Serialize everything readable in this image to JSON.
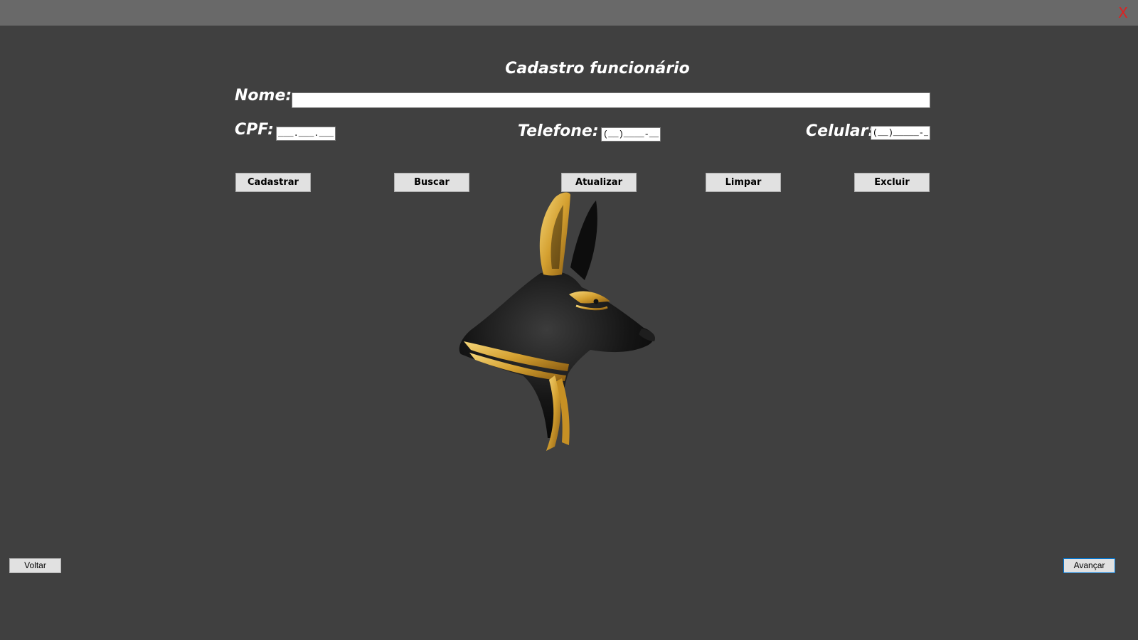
{
  "window": {
    "close_label": "X"
  },
  "form": {
    "title": "Cadastro funcionário",
    "nome_label": "Nome:",
    "nome_value": "",
    "cpf_label": "CPF:",
    "cpf_mask": "___.___.___-__",
    "telefone_label": "Telefone:",
    "telefone_mask": "(__)____-____",
    "celular_label": "Celular:",
    "celular_mask": "(__)_____-____"
  },
  "actions": {
    "cadastrar": "Cadastrar",
    "buscar": "Buscar",
    "atualizar": "Atualizar",
    "limpar": "Limpar",
    "excluir": "Excluir"
  },
  "navigation": {
    "voltar": "Voltar",
    "avancar": "Avançar"
  },
  "logo": {
    "icon": "anubis-head-logo"
  },
  "colors": {
    "background": "#404040",
    "titlebar": "#696969",
    "close": "#e02020",
    "gold": "#d4a030"
  }
}
